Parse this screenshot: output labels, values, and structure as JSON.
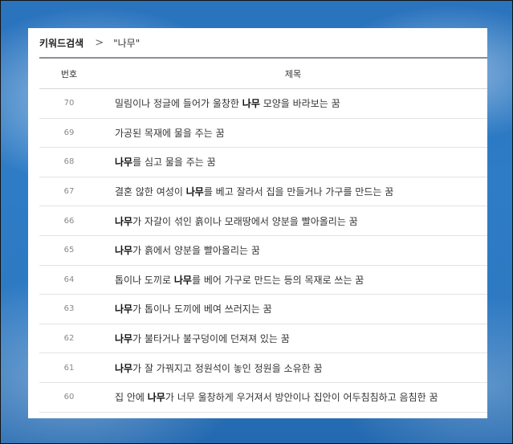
{
  "breadcrumb": {
    "root": "키워드검색",
    "separator": ">",
    "current": "\"나무\""
  },
  "table": {
    "headers": {
      "number": "번호",
      "title": "제목"
    },
    "keyword": "나무",
    "rows": [
      {
        "number": "70",
        "before": "밀림이나 정글에 들어가 울창한 ",
        "after": " 모양을 바라보는 꿈"
      },
      {
        "number": "69",
        "before": "가공된 목재에 물을 주는 꿈",
        "after": ""
      },
      {
        "number": "68",
        "before": "",
        "after": "를 심고 물을 주는 꿈"
      },
      {
        "number": "67",
        "before": "결혼 않한 여성이 ",
        "after": "를 베고 잘라서 집을 만들거나 가구를 만드는 꿈"
      },
      {
        "number": "66",
        "before": "",
        "after": "가 자갈이 섞인 흙이나 모래땅에서 양분을 빨아올리는 꿈"
      },
      {
        "number": "65",
        "before": "",
        "after": "가 흙에서 양분을 빨아올리는 꿈"
      },
      {
        "number": "64",
        "before": "톱이나 도끼로 ",
        "after": "를 베어 가구로 만드는 등의 목재로 쓰는 꿈"
      },
      {
        "number": "63",
        "before": "",
        "after": "가 톱이나 도끼에 베여 쓰러지는 꿈"
      },
      {
        "number": "62",
        "before": "",
        "after": "가 불타거나 불구덩이에 던져져 있는 꿈"
      },
      {
        "number": "61",
        "before": "",
        "after": "가 잘 가꿔지고 정원석이 놓인 정원을 소유한 꿈"
      },
      {
        "number": "60",
        "before": "집 안에 ",
        "after": "가 너무 울창하게 우거져서 방안이나 집안이 어두침침하고 음침한 꿈"
      }
    ]
  }
}
